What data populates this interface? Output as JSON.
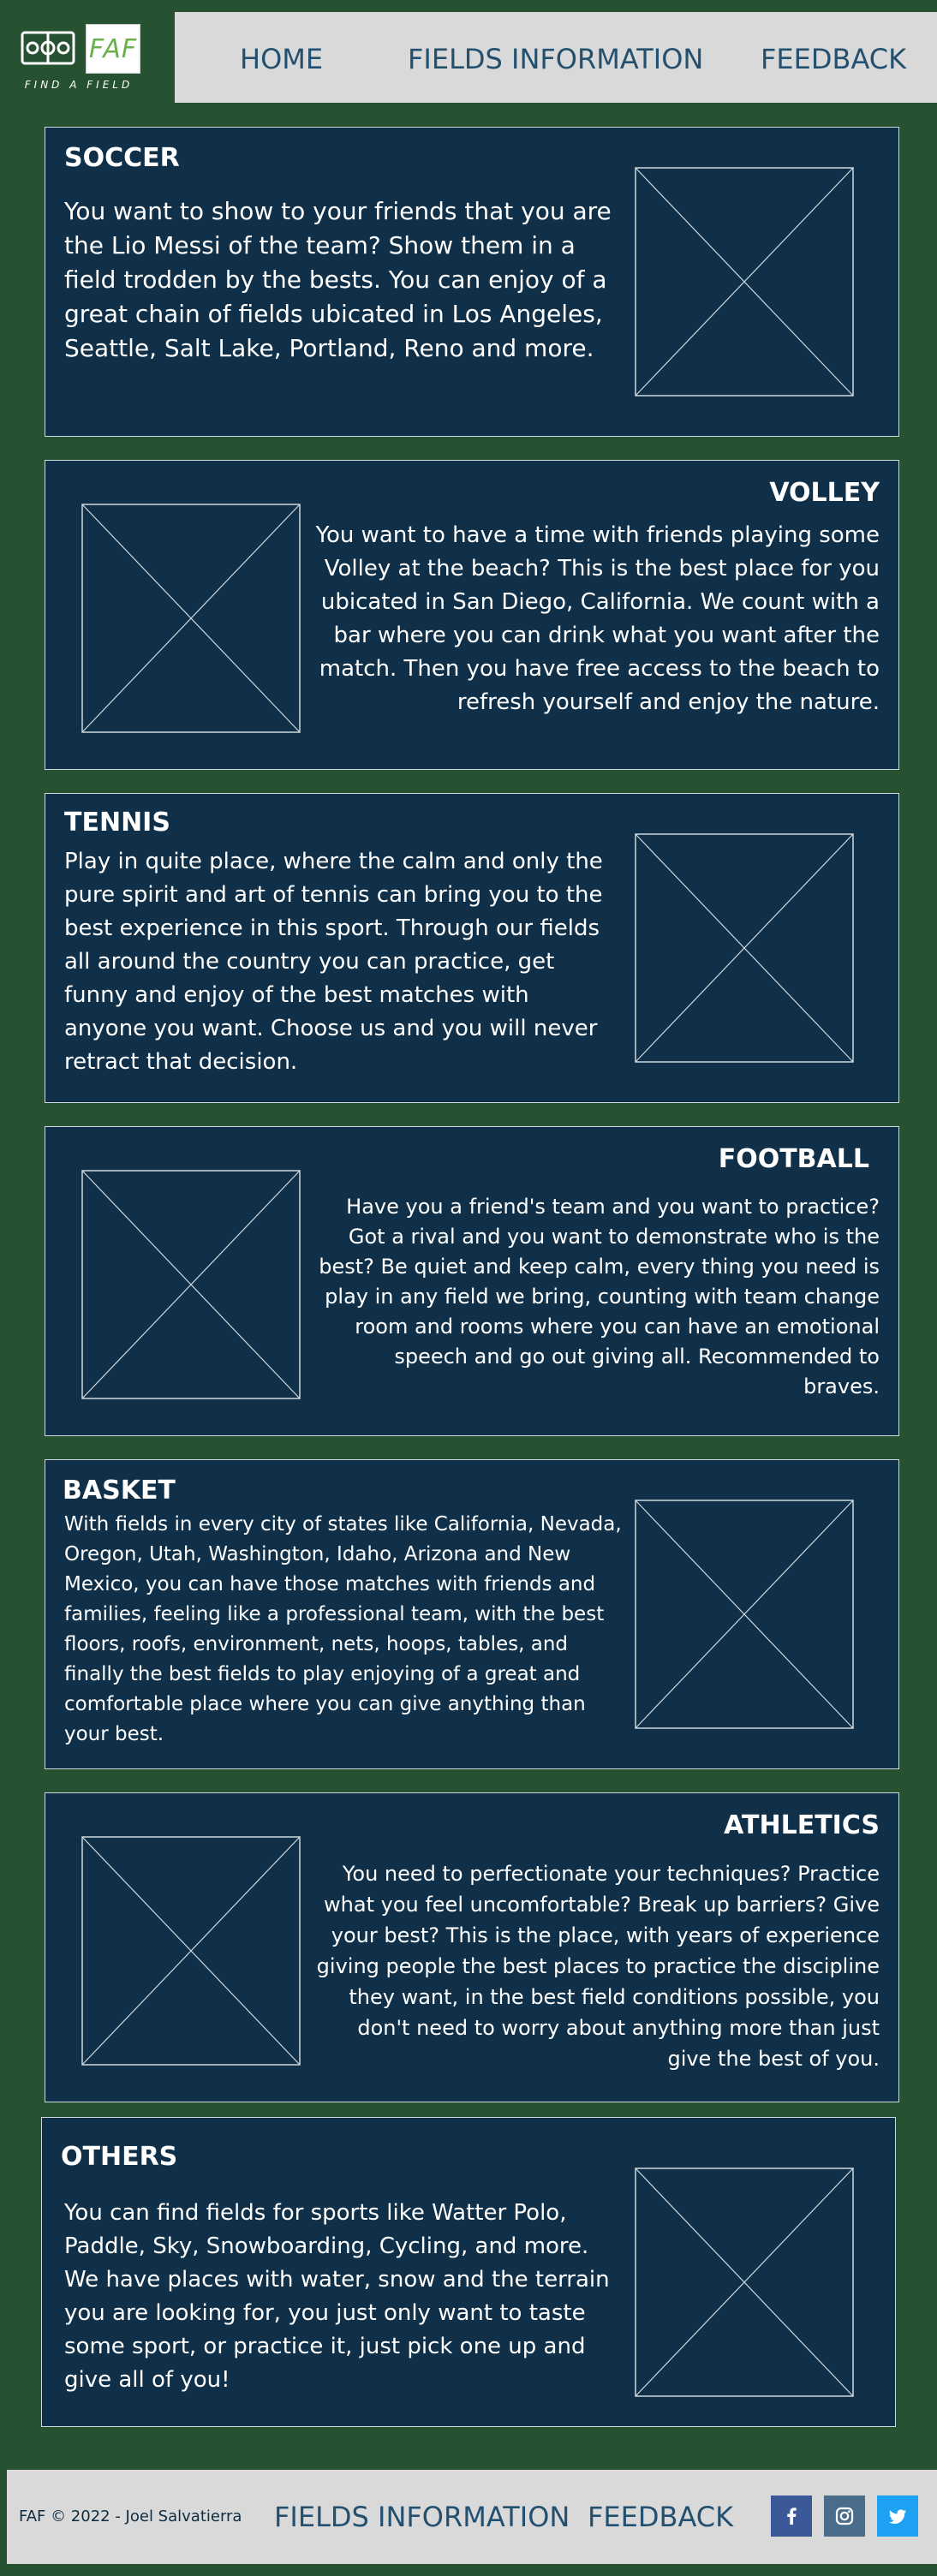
{
  "brand": {
    "name": "FAF",
    "tagline": "FIND A FIELD"
  },
  "nav": {
    "home": "HOME",
    "fields": "FIELDS INFORMATION",
    "feedback": "FEEDBACK"
  },
  "sections": [
    {
      "title": "SOCCER",
      "text": "You want to show to your friends that you are the Lio Messi of the team? Show them in a field trodden by the bests. You can enjoy of a great chain of fields ubicated in Los Angeles, Seattle, Salt Lake, Portland, Reno and more."
    },
    {
      "title": "VOLLEY",
      "text": "You want to have a time with friends playing some Volley at the beach? This is the best place for you ubicated in San Diego, California. We count with a bar where you can drink what you want after the match. Then you have free access to the beach to refresh yourself and enjoy the nature."
    },
    {
      "title": "TENNIS",
      "text": "Play in quite place, where the calm and only the pure spirit and art of tennis can bring you to the best experience in this sport. Through our fields all around the country you can practice, get funny and enjoy of the best matches with anyone you want. Choose us and you will never retract that decision."
    },
    {
      "title": "FOOTBALL",
      "text": "Have you a friend's team and you want to practice? Got a rival and you want to demonstrate who is the best? Be quiet and keep calm, every thing you need is play in any field we bring, counting with team change room and rooms where you can have an emotional speech and go out giving all. Recommended to braves."
    },
    {
      "title": "BASKET",
      "text": "With fields in every city of states like California, Nevada, Oregon, Utah, Washington, Idaho, Arizona and New Mexico, you can have those matches with friends and families, feeling like a professional team, with the best floors, roofs, environment, nets, hoops, tables, and finally the best fields to play enjoying of a great and comfortable place where you can give anything than your best."
    },
    {
      "title": "ATHLETICS",
      "text": "You need to perfectionate your techniques? Practice what you feel uncomfortable? Break up barriers? Give your best? This is the place, with years of experience giving people the best places to practice the discipline they want, in the best field conditions possible, you don't need to worry about anything more than just give the best of you."
    },
    {
      "title": "OTHERS",
      "text": "You can find fields for sports like Watter Polo, Paddle, Sky, Snowboarding, Cycling, and more. We have places with water, snow and the terrain you are looking for, you just only want to taste some sport, or practice it, just pick one up and give all of you!"
    }
  ],
  "footer": {
    "copyright": "FAF © 2022 - Joel Salvatierra",
    "fields": "FIELDS INFORMATION",
    "feedback": "FEEDBACK",
    "social": [
      {
        "icon": "facebook-icon",
        "color": "#3b5998"
      },
      {
        "icon": "instagram-icon",
        "color": "#4a6d8c"
      },
      {
        "icon": "twitter-icon",
        "color": "#1da1f2"
      }
    ]
  },
  "colors": {
    "page_background": "#275232",
    "card_background": "#0f3048",
    "nav_background": "#d9d9d9",
    "nav_text": "#24506f",
    "brand_green": "#6ab04c"
  }
}
